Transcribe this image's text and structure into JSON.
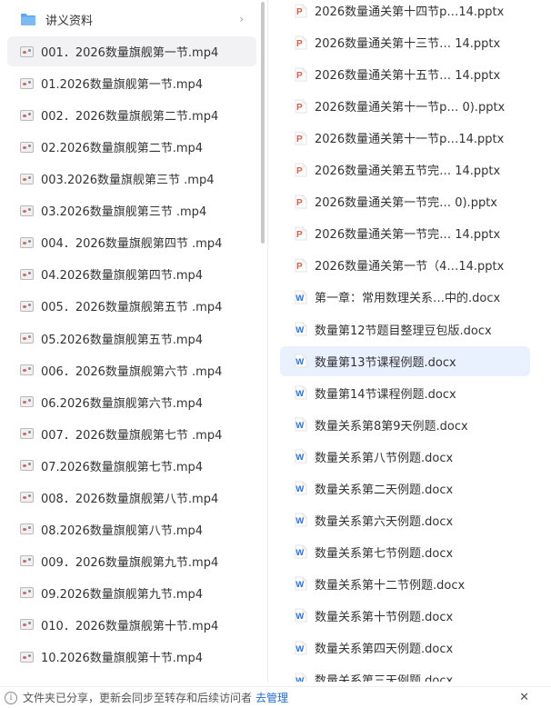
{
  "left_items": [
    {
      "label": "讲义资料",
      "icon": "folder-icon",
      "has_chevron": true
    },
    {
      "label": "001．2026数量旗舰第一节.mp4",
      "icon": "video-thumbnail-icon",
      "selected": true
    },
    {
      "label": "01.2026数量旗舰第一节.mp4",
      "icon": "video-thumbnail-icon"
    },
    {
      "label": "002．2026数量旗舰第二节.mp4",
      "icon": "video-thumbnail-icon"
    },
    {
      "label": "02.2026数量旗舰第二节.mp4",
      "icon": "video-thumbnail-icon"
    },
    {
      "label": "003.2026数量旗舰第三节 .mp4",
      "icon": "video-thumbnail-icon"
    },
    {
      "label": "03.2026数量旗舰第三节 .mp4",
      "icon": "video-thumbnail-icon"
    },
    {
      "label": "004．2026数量旗舰第四节 .mp4",
      "icon": "video-thumbnail-icon"
    },
    {
      "label": "04.2026数量旗舰第四节.mp4",
      "icon": "video-thumbnail-icon"
    },
    {
      "label": "005．2026数量旗舰第五节 .mp4",
      "icon": "video-thumbnail-icon"
    },
    {
      "label": "05.2026数量旗舰第五节.mp4",
      "icon": "video-thumbnail-icon"
    },
    {
      "label": "006．2026数量旗舰第六节 .mp4",
      "icon": "video-thumbnail-icon"
    },
    {
      "label": "06.2026数量旗舰第六节.mp4",
      "icon": "video-thumbnail-icon"
    },
    {
      "label": "007．2026数量旗舰第七节 .mp4",
      "icon": "video-thumbnail-icon"
    },
    {
      "label": "07.2026数量旗舰第七节.mp4",
      "icon": "video-thumbnail-icon"
    },
    {
      "label": "008．2026数量旗舰第八节.mp4",
      "icon": "video-thumbnail-icon"
    },
    {
      "label": "08.2026数量旗舰第八节.mp4",
      "icon": "video-thumbnail-icon"
    },
    {
      "label": "009．2026数量旗舰第九节.mp4",
      "icon": "video-thumbnail-icon"
    },
    {
      "label": "09.2026数量旗舰第九节.mp4",
      "icon": "video-thumbnail-icon"
    },
    {
      "label": "010．2026数量旗舰第十节.mp4",
      "icon": "video-thumbnail-icon"
    },
    {
      "label": "10.2026数量旗舰第十节.mp4",
      "icon": "video-thumbnail-icon"
    }
  ],
  "right_items": [
    {
      "label": "2026数量通关第十四节p…14.pptx",
      "icon": "pptx-icon"
    },
    {
      "label": "2026数量通关第十三节… 14.pptx",
      "icon": "pptx-icon"
    },
    {
      "label": "2026数量通关第十五节… 14.pptx",
      "icon": "pptx-icon"
    },
    {
      "label": "2026数量通关第十一节p… 0).pptx",
      "icon": "pptx-icon"
    },
    {
      "label": "2026数量通关第十一节p…14.pptx",
      "icon": "pptx-icon"
    },
    {
      "label": "2026数量通关第五节完… 14.pptx",
      "icon": "pptx-icon"
    },
    {
      "label": "2026数量通关第一节完… 0).pptx",
      "icon": "pptx-icon"
    },
    {
      "label": "2026数量通关第一节完… 14.pptx",
      "icon": "pptx-icon"
    },
    {
      "label": "2026数量通关第一节（4…14.pptx",
      "icon": "pptx-icon"
    },
    {
      "label": "第一章：常用数理关系…中的.docx",
      "icon": "docx-icon"
    },
    {
      "label": "数量第12节题目整理豆包版.docx",
      "icon": "docx-icon"
    },
    {
      "label": "数量第13节课程例题.docx",
      "icon": "docx-icon",
      "highlighted": true
    },
    {
      "label": "数量第14节课程例题.docx",
      "icon": "docx-icon"
    },
    {
      "label": "数量关系第8第9天例题.docx",
      "icon": "docx-icon"
    },
    {
      "label": "数量关系第八节例题.docx",
      "icon": "docx-icon"
    },
    {
      "label": "数量关系第二天例题.docx",
      "icon": "docx-icon"
    },
    {
      "label": "数量关系第六天例题.docx",
      "icon": "docx-icon"
    },
    {
      "label": "数量关系第七节例题.docx",
      "icon": "docx-icon"
    },
    {
      "label": "数量关系第十二节例题.docx",
      "icon": "docx-icon"
    },
    {
      "label": "数量关系第十节例题.docx",
      "icon": "docx-icon"
    },
    {
      "label": "数量关系第四天例题.docx",
      "icon": "docx-icon"
    },
    {
      "label": "数量关系第三天例题.docx",
      "icon": "docx-icon"
    }
  ],
  "footer": {
    "message": "文件夹已分享，更新会同步至转存和后续访问者",
    "link_label": "去管理"
  },
  "colors": {
    "accent": "#1e6bd6",
    "pptx_icon": "#e8573f",
    "docx_icon": "#2f6fe0",
    "folder_icon": "#5aa6f5",
    "selected_bg": "#f2f2f4",
    "highlight_bg": "#eaf1fe"
  }
}
